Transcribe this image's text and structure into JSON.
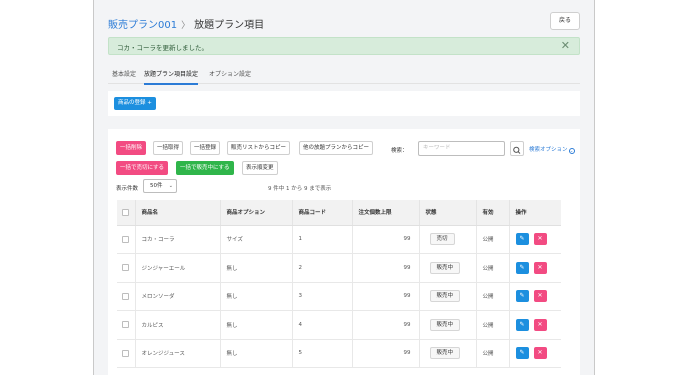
{
  "header": {
    "breadcrumb_parent": "販売プラン001",
    "breadcrumb_sep": "〉",
    "breadcrumb_current": "放題プラン項目",
    "back_label": "戻る"
  },
  "alert": {
    "message": "コカ・コーラを更新しました。",
    "close": "✕"
  },
  "tabs": [
    {
      "label": "基本設定",
      "active": false
    },
    {
      "label": "放題プラン項目設定",
      "active": true
    },
    {
      "label": "オプション設定",
      "active": false
    }
  ],
  "register_button": "商品の登録 +",
  "toolbar": {
    "bulk_delete": "一括削除",
    "bulk_fetch": "一括取得",
    "bulk_register": "一括登録",
    "copy_from_sales_list": "販売リストからコピー",
    "copy_from_other_plan": "他の放題プランからコピー",
    "keyword_label": "検索：",
    "keyword_placeholder": "キーワード",
    "search_options": "検索オプション",
    "bulk_sold_out": "一括で売切にする",
    "bulk_on_sale": "一括で販売中にする",
    "change_order": "表示順変更"
  },
  "pagination": {
    "per_page_label": "表示件数",
    "per_page_value": "50件",
    "caret": "⌄",
    "range_info": "9 件中 1 から 9 まで表示"
  },
  "table": {
    "columns": [
      "商品名",
      "商品オプション",
      "商品コード",
      "注文個数上限",
      "状態",
      "有効",
      "操作"
    ],
    "rows": [
      {
        "name": "コカ・コーラ",
        "option": "サイズ",
        "code": "1",
        "limit": "99",
        "status": "売切",
        "valid": "公開"
      },
      {
        "name": "ジンジャーエール",
        "option": "無し",
        "code": "2",
        "limit": "99",
        "status": "販売中",
        "valid": "公開"
      },
      {
        "name": "メロンソーダ",
        "option": "無し",
        "code": "3",
        "limit": "99",
        "status": "販売中",
        "valid": "公開"
      },
      {
        "name": "カルピス",
        "option": "無し",
        "code": "4",
        "limit": "99",
        "status": "販売中",
        "valid": "公開"
      },
      {
        "name": "オレンジジュース",
        "option": "無し",
        "code": "5",
        "limit": "99",
        "status": "販売中",
        "valid": "公開"
      }
    ]
  },
  "icons": {
    "edit": "✎",
    "delete": "✕",
    "search": "search-icon"
  },
  "colors": {
    "primary": "#1c8fdf",
    "danger": "#f24b82",
    "success": "#2fb54a",
    "alert_bg": "#d7ecdb",
    "link": "#2b7bd6"
  }
}
